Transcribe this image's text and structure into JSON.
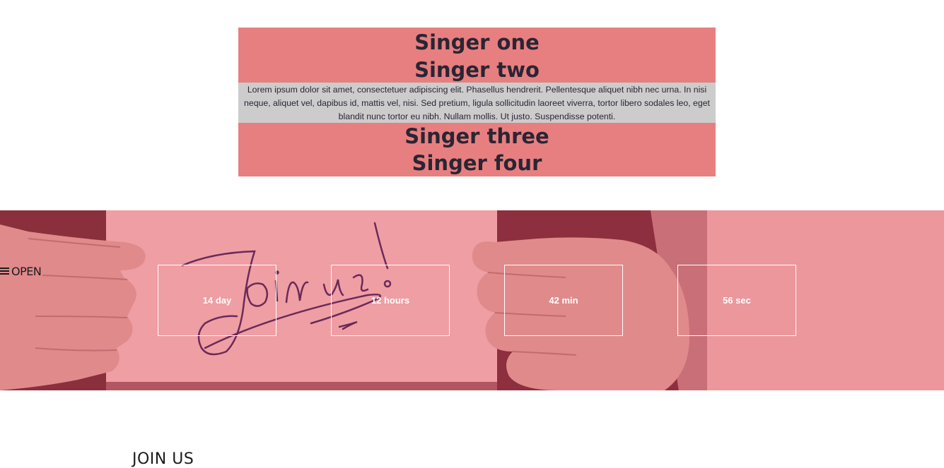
{
  "singers": {
    "top": [
      "Singer one",
      "Singer two"
    ],
    "text": "Lorem ipsum dolor sit amet, consectetuer adipiscing elit. Phasellus hendrerit. Pellentesque aliquet nibh nec urna. In nisi neque, aliquet vel, dapibus id, mattis vel, nisi. Sed pretium, ligula sollicitudin laoreet viverra, tortor libero sodales leo, eget blandit nunc tortor eu nibh. Nullam mollis. Ut justo. Suspendisse potenti.",
    "bottom": [
      "Singer three",
      "Singer four"
    ]
  },
  "menu": {
    "icon": "hamburger-icon",
    "label": "OPEN"
  },
  "banner": {
    "handwriting": "Join us!",
    "countdown": [
      "14 day",
      "12 hours",
      "42 min",
      "56 sec"
    ]
  },
  "section": {
    "heading": "JOIN US"
  },
  "colors": {
    "singer_bg": "#e77f80",
    "lorem_bg": "#cccccc",
    "banner_tint": "#ec979c",
    "text_dark": "#2a2533"
  }
}
